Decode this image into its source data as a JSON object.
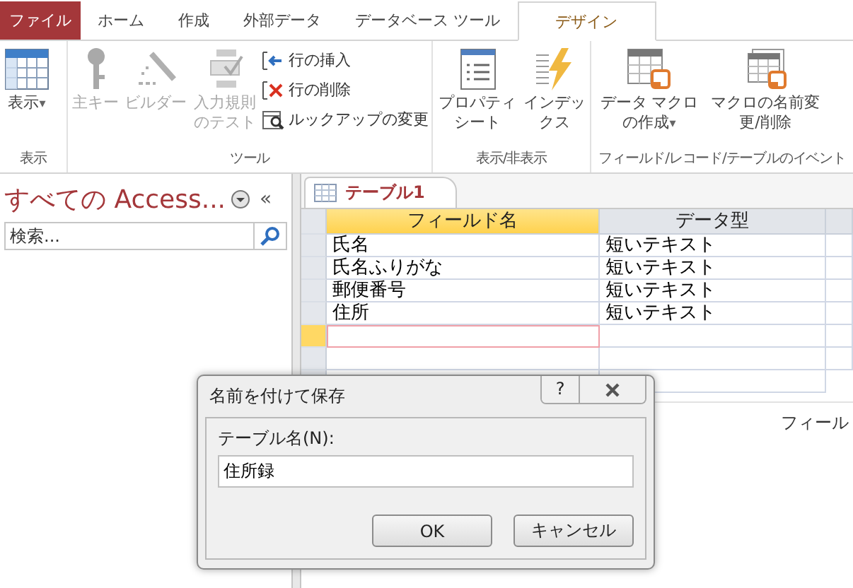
{
  "ribbon_tabs": [
    {
      "label": "ファイル",
      "kind": "file",
      "selected": false
    },
    {
      "label": "ホーム",
      "kind": "tab",
      "selected": false
    },
    {
      "label": "作成",
      "kind": "tab",
      "selected": false
    },
    {
      "label": "外部データ",
      "kind": "tab",
      "selected": false
    },
    {
      "label": "データベース ツール",
      "kind": "tab",
      "selected": false
    },
    {
      "label": "デザイン",
      "kind": "tab",
      "selected": true
    }
  ],
  "ribbon_groups": [
    {
      "label": "表示",
      "items": [
        {
          "kind": "large",
          "label": "表示",
          "disabled": false,
          "dropdown": "▾"
        }
      ]
    },
    {
      "label": "ツール",
      "items": [
        {
          "kind": "large",
          "label": "主キー",
          "disabled": true
        },
        {
          "kind": "large",
          "label": "ビルダー",
          "disabled": true
        },
        {
          "kind": "large",
          "label": "入力規則のテスト",
          "disabled": true
        },
        {
          "kind": "small",
          "label": "行の挿入",
          "disabled": false
        },
        {
          "kind": "small",
          "label": "行の削除",
          "disabled": false
        },
        {
          "kind": "small",
          "label": "ルックアップの変更",
          "disabled": false
        }
      ]
    },
    {
      "label": "表示/非表示",
      "items": [
        {
          "kind": "large",
          "label": "プロパティシート",
          "disabled": false
        },
        {
          "kind": "large",
          "label": "インデックス",
          "disabled": false
        }
      ]
    },
    {
      "label": "フィールド/レコード/テーブルのイベント",
      "items": [
        {
          "kind": "large",
          "label": "データ マクロの作成",
          "disabled": false,
          "dropdown": "▾"
        },
        {
          "kind": "large",
          "label": "マクロの名前変更/削除",
          "disabled": false
        }
      ]
    }
  ],
  "nav_pane": {
    "title": "すべての Access...",
    "collapse": "«",
    "search": {
      "placeholder": "検索..."
    }
  },
  "document_tab": {
    "label": "テーブル1",
    "selected": true
  },
  "table": {
    "columns": [
      "フィールド名",
      "データ型"
    ],
    "rows": [
      {
        "field": "氏名",
        "type": "短いテキスト",
        "selected": false
      },
      {
        "field": "氏名ふりがな",
        "type": "短いテキスト",
        "selected": false
      },
      {
        "field": "郵便番号",
        "type": "短いテキスト",
        "selected": false
      },
      {
        "field": "住所",
        "type": "短いテキスト",
        "selected": false
      },
      {
        "selected": true
      },
      {
        "selected": false
      }
    ]
  },
  "field_properties_label": "フィール",
  "dialog": {
    "title": "名前を付けて保存",
    "help": "?",
    "label": "テーブル名(N):",
    "value": "住所録",
    "buttons": [
      "OK",
      "キャンセル"
    ]
  }
}
